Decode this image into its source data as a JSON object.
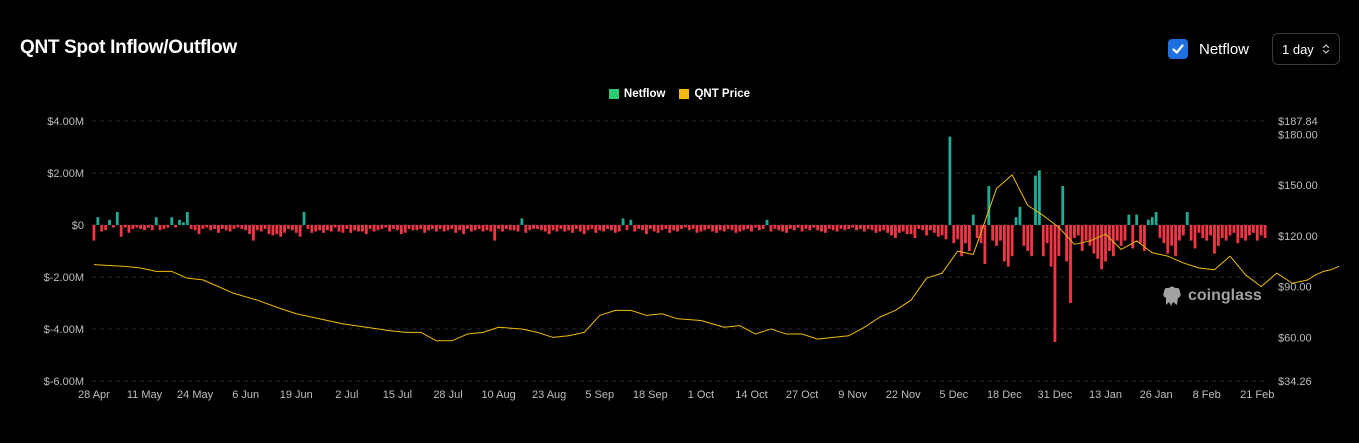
{
  "header": {
    "title": "QNT Spot Inflow/Outflow",
    "netflow_toggle_label": "Netflow",
    "netflow_checked": true,
    "interval_value": "1 day"
  },
  "watermark": "coinglass",
  "colors": {
    "background": "#000000",
    "inflow": "#22ab94",
    "outflow": "#f23645",
    "price": "#f0b90b",
    "checkbox": "#1e6fe0"
  },
  "chart_data": {
    "type": "bar",
    "grid": true,
    "legend_position": "top-center",
    "legend": [
      {
        "name": "Netflow",
        "color": "#2ecc71"
      },
      {
        "name": "QNT Price",
        "color": "#f0b90b"
      }
    ],
    "x_tick_labels": [
      "28 Apr",
      "11 May",
      "24 May",
      "6 Jun",
      "19 Jun",
      "2 Jul",
      "15 Jul",
      "28 Jul",
      "10 Aug",
      "23 Aug",
      "5 Sep",
      "18 Sep",
      "1 Oct",
      "14 Oct",
      "27 Oct",
      "9 Nov",
      "22 Nov",
      "5 Dec",
      "18 Dec",
      "31 Dec",
      "13 Jan",
      "26 Jan",
      "8 Feb",
      "21 Feb"
    ],
    "y_left": {
      "min": -6000000,
      "max": 4000000,
      "ticks": [
        4000000,
        2000000,
        0,
        -2000000,
        -4000000,
        -6000000
      ],
      "tick_labels": [
        "$4.00M",
        "$2.00M",
        "$0",
        "$-2.00M",
        "$-4.00M",
        "$-6.00M"
      ]
    },
    "y_right": {
      "min": 34.26,
      "max": 187.84,
      "ticks": [
        187.84,
        180,
        150,
        120,
        90,
        60,
        34.26
      ],
      "tick_labels": [
        "$187.84",
        "$180.00",
        "$150.00",
        "$120.00",
        "$90.00",
        "$60.00",
        "$34.26"
      ]
    },
    "series": [
      {
        "name": "Netflow",
        "axis": "left",
        "unit": "USD",
        "start": "2024-04-28",
        "values": [
          -600000,
          300000,
          -250000,
          -200000,
          200000,
          -100000,
          500000,
          -450000,
          -100000,
          -300000,
          -150000,
          -100000,
          -150000,
          -200000,
          -100000,
          -200000,
          300000,
          -200000,
          -150000,
          -100000,
          300000,
          -100000,
          200000,
          100000,
          500000,
          -150000,
          -200000,
          -350000,
          -150000,
          -100000,
          -200000,
          -150000,
          -300000,
          -150000,
          -200000,
          -250000,
          -150000,
          -100000,
          -150000,
          -200000,
          -350000,
          -600000,
          -200000,
          -250000,
          -150000,
          -350000,
          -400000,
          -350000,
          -450000,
          -300000,
          -150000,
          -200000,
          -300000,
          -450000,
          500000,
          -150000,
          -300000,
          -250000,
          -200000,
          -300000,
          -200000,
          -250000,
          -100000,
          -250000,
          -300000,
          -150000,
          -300000,
          -200000,
          -250000,
          -250000,
          -350000,
          -150000,
          -250000,
          -200000,
          -150000,
          -100000,
          -250000,
          -150000,
          -200000,
          -350000,
          -300000,
          -150000,
          -200000,
          -200000,
          -150000,
          -300000,
          -200000,
          -150000,
          -250000,
          -150000,
          -250000,
          -200000,
          -150000,
          -300000,
          -200000,
          -350000,
          -150000,
          -250000,
          -200000,
          -150000,
          -250000,
          -200000,
          -250000,
          -600000,
          -150000,
          -250000,
          -150000,
          -200000,
          -200000,
          -250000,
          250000,
          -300000,
          -200000,
          -150000,
          -150000,
          -200000,
          -250000,
          -350000,
          -200000,
          -250000,
          -150000,
          -250000,
          -200000,
          -300000,
          -150000,
          -250000,
          -350000,
          -200000,
          -150000,
          -300000,
          -200000,
          -250000,
          -150000,
          -200000,
          -300000,
          -250000,
          250000,
          -200000,
          200000,
          -250000,
          -150000,
          -200000,
          -350000,
          -150000,
          -250000,
          -300000,
          -200000,
          -150000,
          -300000,
          -200000,
          -250000,
          -150000,
          -100000,
          -200000,
          -150000,
          -300000,
          -250000,
          -200000,
          -150000,
          -250000,
          -300000,
          -200000,
          -250000,
          -150000,
          -200000,
          -300000,
          -250000,
          -200000,
          -150000,
          -250000,
          -100000,
          -200000,
          -150000,
          200000,
          -250000,
          -150000,
          -200000,
          -250000,
          -300000,
          -150000,
          -200000,
          -100000,
          -250000,
          -150000,
          -200000,
          -100000,
          -200000,
          -250000,
          -300000,
          -150000,
          -200000,
          -250000,
          -150000,
          -200000,
          -150000,
          -100000,
          -200000,
          -150000,
          -250000,
          -150000,
          -200000,
          -300000,
          -250000,
          -200000,
          -300000,
          -400000,
          -500000,
          -300000,
          -250000,
          -350000,
          -350000,
          -500000,
          -150000,
          -200000,
          -400000,
          -200000,
          -300000,
          -450000,
          -400000,
          -550000,
          3400000,
          -700000,
          -550000,
          -1200000,
          -700000,
          -1000000,
          400000,
          -500000,
          -700000,
          -1500000,
          1500000,
          -600000,
          -800000,
          -600000,
          -1400000,
          -1600000,
          -1200000,
          300000,
          700000,
          -800000,
          -1000000,
          -1200000,
          1900000,
          2100000,
          -1200000,
          -700000,
          -1600000,
          -4500000,
          -1200000,
          1500000,
          -1400000,
          -3000000,
          -500000,
          -400000,
          -1000000,
          -600000,
          -800000,
          -1100000,
          -1300000,
          -1700000,
          -1400000,
          -1000000,
          -1200000,
          -600000,
          -800000,
          -600000,
          400000,
          -900000,
          400000,
          -700000,
          -1000000,
          200000,
          300000,
          500000,
          -500000,
          -700000,
          -1100000,
          -800000,
          -1200000,
          -600000,
          -400000,
          500000,
          -600000,
          -900000,
          -300000,
          -500000,
          -600000,
          -400000,
          -1100000,
          -800000,
          -500000,
          -600000,
          -400000,
          -300000,
          -700000,
          -500000,
          -600000,
          -400000,
          -300000,
          -600000,
          -400000,
          -500000
        ]
      },
      {
        "name": "QNT Price",
        "axis": "right",
        "unit": "USD",
        "x_index": [
          0,
          8,
          12,
          16,
          20,
          24,
          28,
          32,
          36,
          42,
          48,
          52,
          56,
          60,
          64,
          70,
          76,
          80,
          84,
          88,
          92,
          96,
          100,
          104,
          110,
          114,
          118,
          122,
          126,
          130,
          134,
          138,
          142,
          146,
          150,
          156,
          162,
          166,
          170,
          174,
          178,
          182,
          186,
          190,
          194,
          198,
          202,
          206,
          210,
          214,
          218,
          222,
          226,
          232,
          236,
          240,
          244,
          248,
          252,
          256,
          260,
          264,
          268,
          272,
          276,
          280,
          284,
          288,
          292,
          296,
          300,
          304,
          308,
          312,
          314,
          316,
          318,
          320
        ],
        "values": [
          103,
          102,
          101,
          99,
          99,
          95,
          94,
          90,
          86,
          82,
          77,
          74,
          72,
          70,
          68,
          66,
          64,
          63,
          63,
          58,
          58,
          62,
          63,
          66,
          65,
          63,
          60,
          61,
          63,
          73,
          76,
          76,
          73,
          74,
          71,
          70,
          66,
          67,
          62,
          65,
          62,
          62,
          59,
          60,
          61,
          66,
          72,
          76,
          82,
          95,
          98,
          111,
          109,
          148,
          156,
          138,
          132,
          125,
          115,
          117,
          121,
          112,
          117,
          110,
          108,
          104,
          101,
          100,
          108,
          97,
          90,
          98,
          92,
          94,
          97,
          99,
          100,
          102
        ]
      }
    ]
  }
}
